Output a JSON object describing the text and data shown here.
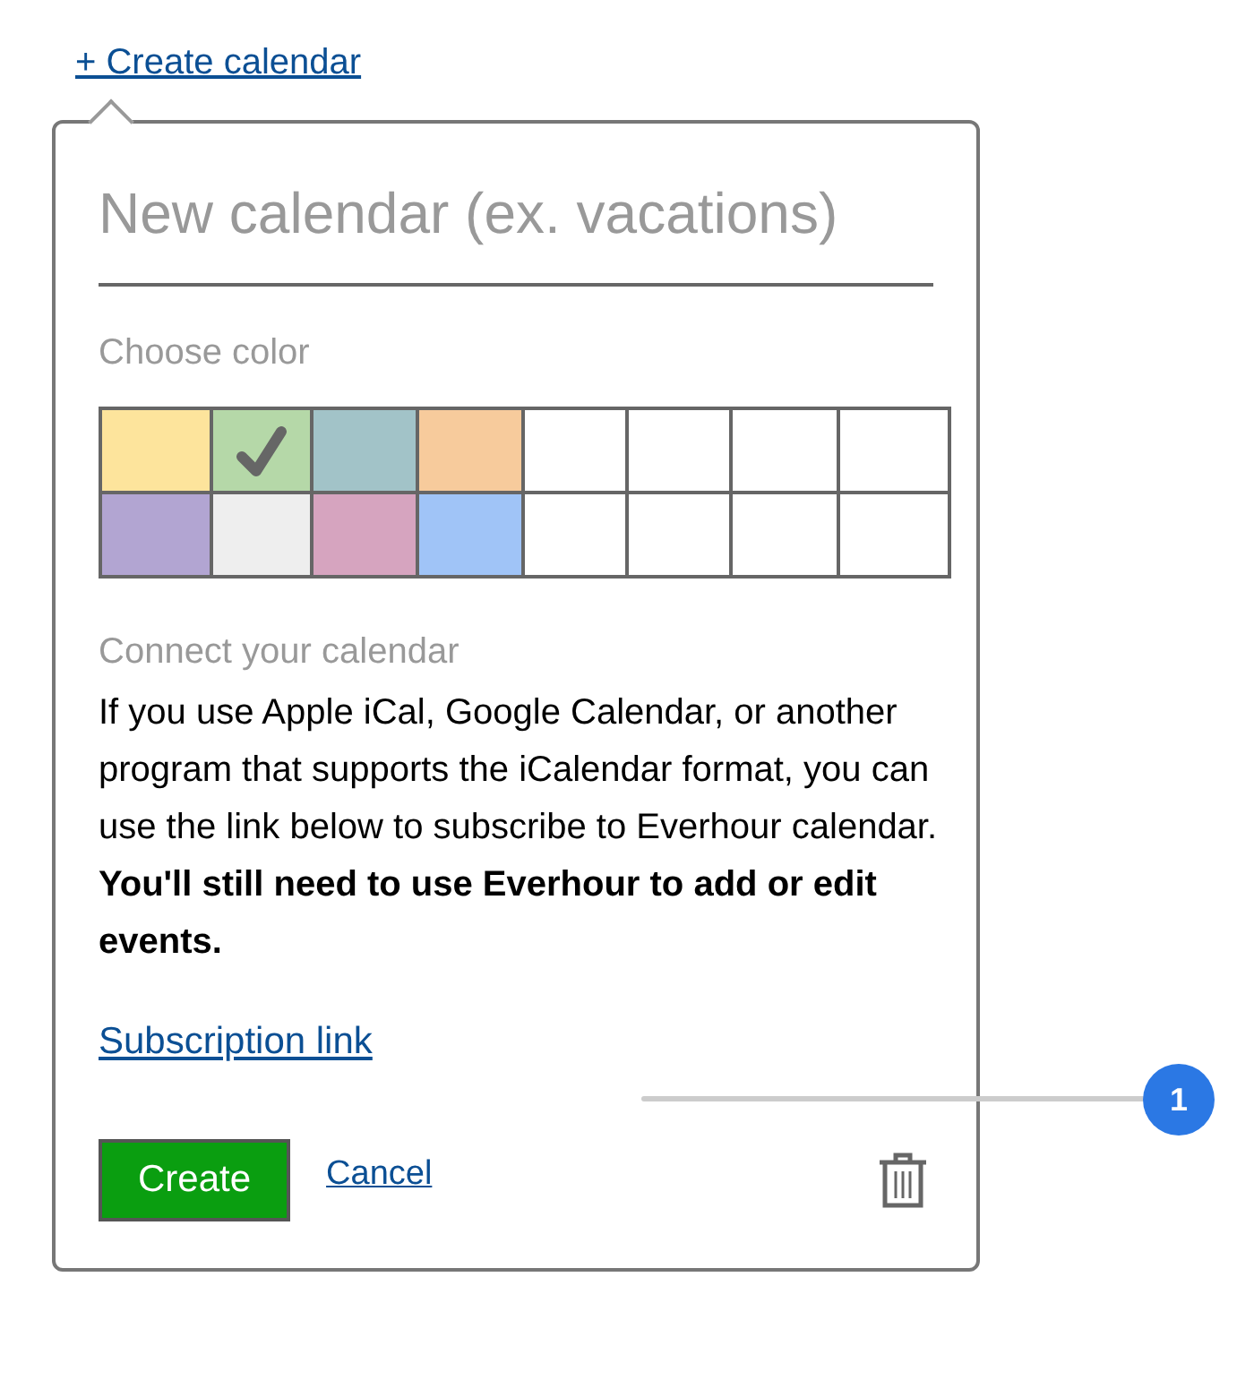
{
  "create_link": "+ Create calendar",
  "popover": {
    "name_field": {
      "placeholder": "New calendar (ex. vacations)"
    },
    "color_label": "Choose color",
    "swatches": [
      {
        "color": "#fde49c",
        "selected": false
      },
      {
        "color": "#b5d8a8",
        "selected": true
      },
      {
        "color": "#a2c3c8",
        "selected": false
      },
      {
        "color": "#f7cb9c",
        "selected": false
      },
      {
        "color": "#ffffff",
        "selected": false
      },
      {
        "color": "#ffffff",
        "selected": false
      },
      {
        "color": "#ffffff",
        "selected": false
      },
      {
        "color": "#ffffff",
        "selected": false
      },
      {
        "color": "#b2a5d2",
        "selected": false
      },
      {
        "color": "#eeeeee",
        "selected": false
      },
      {
        "color": "#d6a4bf",
        "selected": false
      },
      {
        "color": "#a0c4f7",
        "selected": false
      },
      {
        "color": "#ffffff",
        "selected": false
      },
      {
        "color": "#ffffff",
        "selected": false
      },
      {
        "color": "#ffffff",
        "selected": false
      },
      {
        "color": "#ffffff",
        "selected": false
      }
    ],
    "connect_heading": "Connect your calendar",
    "description": "If you use Apple iCal, Google Calendar, or another program that supports the iCalendar format, you can use the link below to subscribe to Everhour calendar. **You'll still need to use Everhour to add or edit events.**",
    "subscription_link": "Subscription link",
    "create_button": "Create",
    "cancel_link": "Cancel"
  },
  "annotation": {
    "number": "1"
  }
}
